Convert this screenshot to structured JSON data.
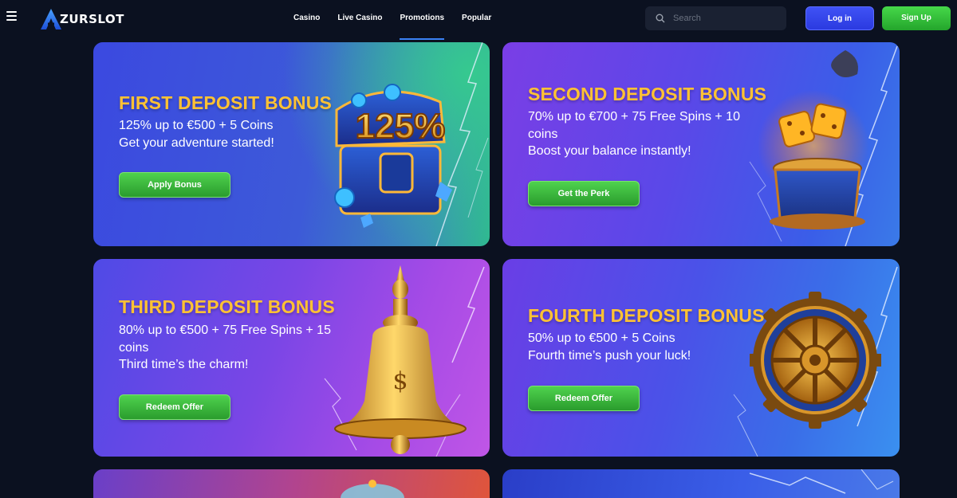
{
  "header": {
    "logo_text": "ZURSLOT",
    "nav": [
      "Casino",
      "Live Casino",
      "Promotions",
      "Popular"
    ],
    "active_nav": "Promotions",
    "search_placeholder": "Search",
    "login_label": "Log in",
    "signup_label": "Sign Up"
  },
  "promotions": [
    {
      "title": "FIRST DEPOSIT BONUS",
      "line1": "125% up to €500 + 5 Coins",
      "line2": "Get your adventure started!",
      "button": "Apply Bonus",
      "art_text": "125%"
    },
    {
      "title": "SECOND DEPOSIT BONUS",
      "line1": "70% up to €700 + 75 Free Spins + 10 coins",
      "line2": "Boost your balance instantly!",
      "button": "Get the Perk"
    },
    {
      "title": "THIRD DEPOSIT BONUS",
      "line1": "80% up to €500 + 75 Free Spins + 15 coins",
      "line2": "Third time’s the charm!",
      "button": "Redeem Offer"
    },
    {
      "title": "FOURTH DEPOSIT BONUS",
      "line1": "50% up to €500 + 5 Coins",
      "line2": "Fourth time’s push your luck!",
      "button": "Redeem Offer"
    }
  ],
  "colors": {
    "background": "#0b1120",
    "title_gold": "#ffc233",
    "login_blue": "#3f52f5",
    "signup_green": "#46d84a",
    "button_green": "#3bbb3a"
  }
}
